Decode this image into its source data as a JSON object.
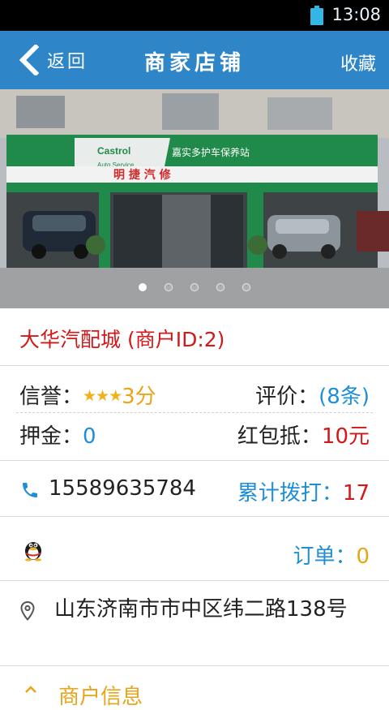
{
  "status_bar": {
    "time": "13:08"
  },
  "app_bar": {
    "back_label": "返回",
    "title": "商家店铺",
    "favorite_label": "收藏"
  },
  "banner": {
    "page_count": 5,
    "active_index": 0,
    "sign_text": "嘉实多护车保养站",
    "sign_brand": "Castrol",
    "sign_sub": "Auto Service",
    "shop_sign": "明 捷 汽 修"
  },
  "store": {
    "name": "大华汽配城 (商户ID:2)",
    "credit_label": "信誉：",
    "credit_stars": "★★★",
    "credit_score": "3分",
    "rating_label": "评价：",
    "rating_count": "(8条)",
    "deposit_label": "押金：",
    "deposit_value": "0",
    "redpacket_label": "红包抵：",
    "redpacket_value": "10元",
    "phone": "15589635784",
    "calls_label": "累计拨打：",
    "calls_value": "17",
    "orders_label": "订单：",
    "orders_value": "0",
    "address": "山东济南市市中区纬二路138号",
    "section_title": "商户信息"
  },
  "colors": {
    "appbar": "#2e86c8",
    "accent_blue": "#1e8ed8",
    "red": "#d21818",
    "orange": "#e9a519"
  }
}
